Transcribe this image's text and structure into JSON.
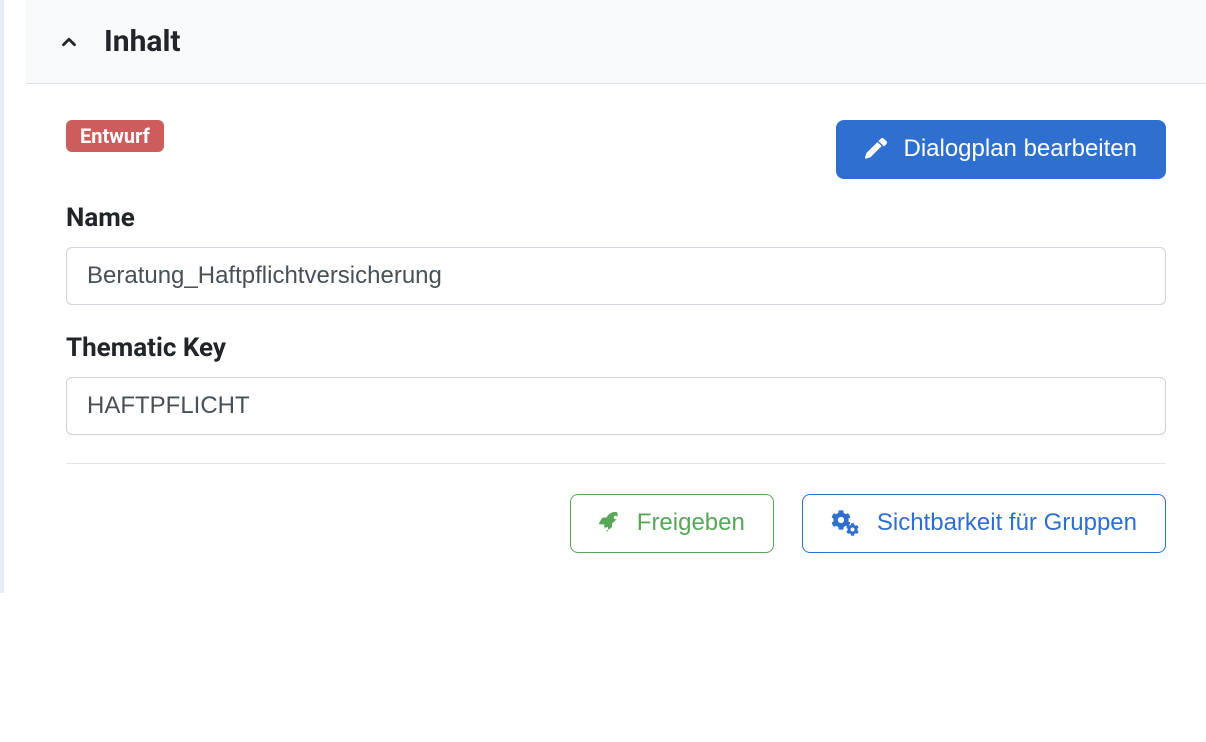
{
  "panel": {
    "title": "Inhalt"
  },
  "status": {
    "badge": "Entwurf"
  },
  "actions": {
    "edit_dialogplan": "Dialogplan bearbeiten",
    "release": "Freigeben",
    "visibility_groups": "Sichtbarkeit für Gruppen"
  },
  "form": {
    "name_label": "Name",
    "name_value": "Beratung_Haftpflichtversicherung",
    "thematic_key_label": "Thematic Key",
    "thematic_key_value": "HAFTPFLICHT"
  }
}
